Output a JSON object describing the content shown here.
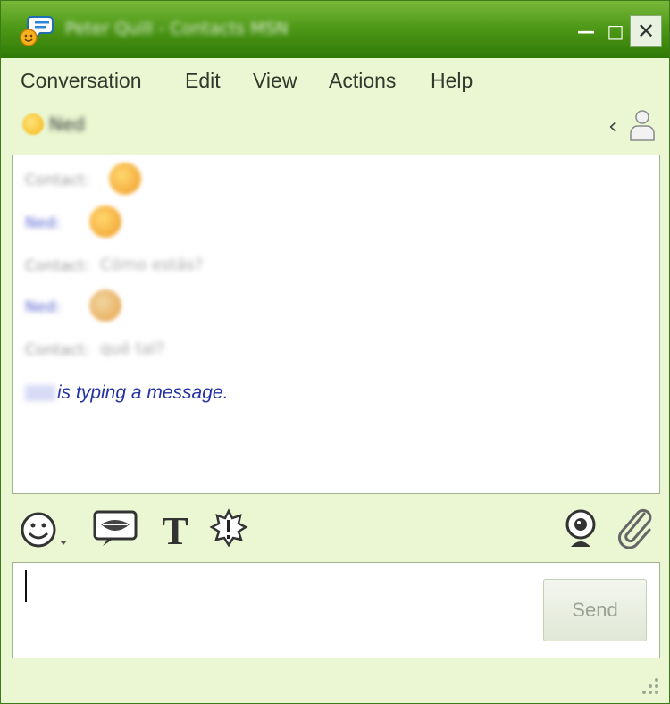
{
  "window": {
    "title": "Peter Quill - Contacts MSN",
    "controls": {
      "minimize": "—",
      "maximize": "□",
      "close": "✕"
    }
  },
  "menu": [
    "Conversation",
    "Edit",
    "View",
    "Actions",
    "Help"
  ],
  "contact": {
    "name": "Ned",
    "status_color": "#f6b61b",
    "collapse_icon": "chevron-left-icon",
    "person_icon": "person-icon"
  },
  "history": {
    "messages": [
      {
        "sender": "Contact:",
        "sender_color": "#999999",
        "text": "",
        "emoticon": "smiley"
      },
      {
        "sender": "Ned:",
        "sender_color": "#5560d0",
        "text": "",
        "emoticon": "smiley"
      },
      {
        "sender": "Contact:",
        "sender_color": "#999999",
        "text": "Cómo estás?",
        "emoticon": ""
      },
      {
        "sender": "Ned:",
        "sender_color": "#5560d0",
        "text": "",
        "emoticon": "smiley"
      },
      {
        "sender": "Contact:",
        "sender_color": "#999999",
        "text": "qué tal?",
        "emoticon": ""
      }
    ],
    "typing_status": "is typing a message."
  },
  "toolbar": {
    "emoticon_icon": "smiley-icon",
    "voice_clip_icon": "lips-icon",
    "font_icon": "text-font-icon",
    "nudge_icon": "nudge-icon",
    "webcam_icon": "webcam-icon",
    "attach_icon": "paperclip-icon"
  },
  "compose": {
    "value": "",
    "send_label": "Send"
  },
  "colors": {
    "title_green": "#4f9a18",
    "panel_bg": "#eaf7d2",
    "typing_blue": "#2432a6"
  }
}
